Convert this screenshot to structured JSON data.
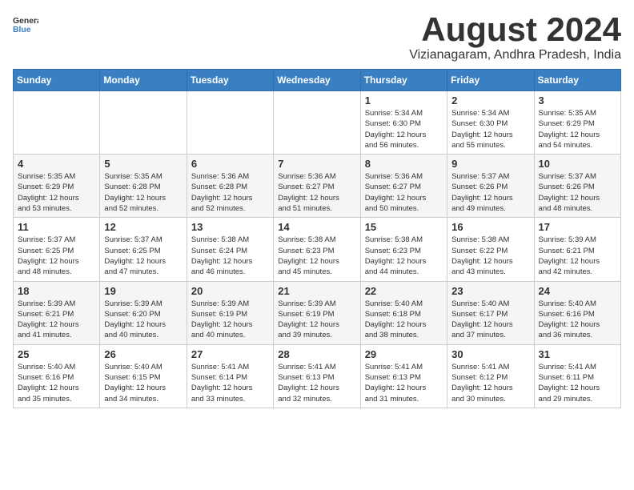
{
  "header": {
    "logo_general": "General",
    "logo_blue": "Blue",
    "month_year": "August 2024",
    "location": "Vizianagaram, Andhra Pradesh, India"
  },
  "days_of_week": [
    "Sunday",
    "Monday",
    "Tuesday",
    "Wednesday",
    "Thursday",
    "Friday",
    "Saturday"
  ],
  "weeks": [
    [
      {
        "day": "",
        "info": ""
      },
      {
        "day": "",
        "info": ""
      },
      {
        "day": "",
        "info": ""
      },
      {
        "day": "",
        "info": ""
      },
      {
        "day": "1",
        "info": "Sunrise: 5:34 AM\nSunset: 6:30 PM\nDaylight: 12 hours\nand 56 minutes."
      },
      {
        "day": "2",
        "info": "Sunrise: 5:34 AM\nSunset: 6:30 PM\nDaylight: 12 hours\nand 55 minutes."
      },
      {
        "day": "3",
        "info": "Sunrise: 5:35 AM\nSunset: 6:29 PM\nDaylight: 12 hours\nand 54 minutes."
      }
    ],
    [
      {
        "day": "4",
        "info": "Sunrise: 5:35 AM\nSunset: 6:29 PM\nDaylight: 12 hours\nand 53 minutes."
      },
      {
        "day": "5",
        "info": "Sunrise: 5:35 AM\nSunset: 6:28 PM\nDaylight: 12 hours\nand 52 minutes."
      },
      {
        "day": "6",
        "info": "Sunrise: 5:36 AM\nSunset: 6:28 PM\nDaylight: 12 hours\nand 52 minutes."
      },
      {
        "day": "7",
        "info": "Sunrise: 5:36 AM\nSunset: 6:27 PM\nDaylight: 12 hours\nand 51 minutes."
      },
      {
        "day": "8",
        "info": "Sunrise: 5:36 AM\nSunset: 6:27 PM\nDaylight: 12 hours\nand 50 minutes."
      },
      {
        "day": "9",
        "info": "Sunrise: 5:37 AM\nSunset: 6:26 PM\nDaylight: 12 hours\nand 49 minutes."
      },
      {
        "day": "10",
        "info": "Sunrise: 5:37 AM\nSunset: 6:26 PM\nDaylight: 12 hours\nand 48 minutes."
      }
    ],
    [
      {
        "day": "11",
        "info": "Sunrise: 5:37 AM\nSunset: 6:25 PM\nDaylight: 12 hours\nand 48 minutes."
      },
      {
        "day": "12",
        "info": "Sunrise: 5:37 AM\nSunset: 6:25 PM\nDaylight: 12 hours\nand 47 minutes."
      },
      {
        "day": "13",
        "info": "Sunrise: 5:38 AM\nSunset: 6:24 PM\nDaylight: 12 hours\nand 46 minutes."
      },
      {
        "day": "14",
        "info": "Sunrise: 5:38 AM\nSunset: 6:23 PM\nDaylight: 12 hours\nand 45 minutes."
      },
      {
        "day": "15",
        "info": "Sunrise: 5:38 AM\nSunset: 6:23 PM\nDaylight: 12 hours\nand 44 minutes."
      },
      {
        "day": "16",
        "info": "Sunrise: 5:38 AM\nSunset: 6:22 PM\nDaylight: 12 hours\nand 43 minutes."
      },
      {
        "day": "17",
        "info": "Sunrise: 5:39 AM\nSunset: 6:21 PM\nDaylight: 12 hours\nand 42 minutes."
      }
    ],
    [
      {
        "day": "18",
        "info": "Sunrise: 5:39 AM\nSunset: 6:21 PM\nDaylight: 12 hours\nand 41 minutes."
      },
      {
        "day": "19",
        "info": "Sunrise: 5:39 AM\nSunset: 6:20 PM\nDaylight: 12 hours\nand 40 minutes."
      },
      {
        "day": "20",
        "info": "Sunrise: 5:39 AM\nSunset: 6:19 PM\nDaylight: 12 hours\nand 40 minutes."
      },
      {
        "day": "21",
        "info": "Sunrise: 5:39 AM\nSunset: 6:19 PM\nDaylight: 12 hours\nand 39 minutes."
      },
      {
        "day": "22",
        "info": "Sunrise: 5:40 AM\nSunset: 6:18 PM\nDaylight: 12 hours\nand 38 minutes."
      },
      {
        "day": "23",
        "info": "Sunrise: 5:40 AM\nSunset: 6:17 PM\nDaylight: 12 hours\nand 37 minutes."
      },
      {
        "day": "24",
        "info": "Sunrise: 5:40 AM\nSunset: 6:16 PM\nDaylight: 12 hours\nand 36 minutes."
      }
    ],
    [
      {
        "day": "25",
        "info": "Sunrise: 5:40 AM\nSunset: 6:16 PM\nDaylight: 12 hours\nand 35 minutes."
      },
      {
        "day": "26",
        "info": "Sunrise: 5:40 AM\nSunset: 6:15 PM\nDaylight: 12 hours\nand 34 minutes."
      },
      {
        "day": "27",
        "info": "Sunrise: 5:41 AM\nSunset: 6:14 PM\nDaylight: 12 hours\nand 33 minutes."
      },
      {
        "day": "28",
        "info": "Sunrise: 5:41 AM\nSunset: 6:13 PM\nDaylight: 12 hours\nand 32 minutes."
      },
      {
        "day": "29",
        "info": "Sunrise: 5:41 AM\nSunset: 6:13 PM\nDaylight: 12 hours\nand 31 minutes."
      },
      {
        "day": "30",
        "info": "Sunrise: 5:41 AM\nSunset: 6:12 PM\nDaylight: 12 hours\nand 30 minutes."
      },
      {
        "day": "31",
        "info": "Sunrise: 5:41 AM\nSunset: 6:11 PM\nDaylight: 12 hours\nand 29 minutes."
      }
    ]
  ]
}
